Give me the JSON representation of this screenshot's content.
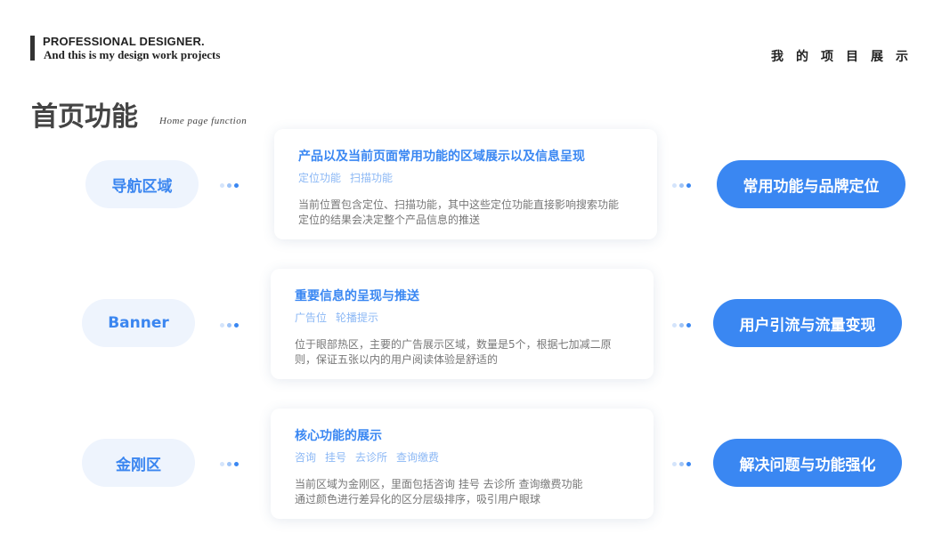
{
  "header": {
    "brand_title": "PROFESSIONAL DESIGNER.",
    "brand_subtitle": "And this is my design work projects",
    "project_label": "我的项目展示"
  },
  "page": {
    "title": "首页功能",
    "subtitle": "Home page function"
  },
  "rows": [
    {
      "left_label": "导航区域",
      "card_title": "产品以及当前页面常用功能的区域展示以及信息呈现",
      "tags": [
        "定位功能",
        "扫描功能"
      ],
      "desc_lines": [
        "当前位置包含定位、扫描功能，其中这些定位功能直接影响搜索功能",
        "定位的结果会决定整个产品信息的推送"
      ],
      "right_label": "常用功能与品牌定位"
    },
    {
      "left_label": "Banner",
      "card_title": "重要信息的呈现与推送",
      "tags": [
        "广告位",
        "轮播提示"
      ],
      "desc_lines": [
        "位于眼部热区，主要的广告展示区域，数量是5个，根据七加减二原",
        "则，保证五张以内的用户阅读体验是舒适的"
      ],
      "right_label": "用户引流与流量变现"
    },
    {
      "left_label": "金刚区",
      "card_title": "核心功能的展示",
      "tags": [
        "咨询",
        "挂号",
        "去诊所",
        "查询缴费"
      ],
      "desc_lines": [
        "当前区域为金刚区，里面包括咨询 挂号 去诊所 查询缴费功能",
        "通过颜色进行差异化的区分层级排序，吸引用户眼球"
      ],
      "right_label": "解决问题与功能强化"
    }
  ],
  "colors": {
    "accent": "#3a87f2",
    "pill_left_bg": "#eef4fd",
    "tag_text": "#8cb8f5"
  }
}
